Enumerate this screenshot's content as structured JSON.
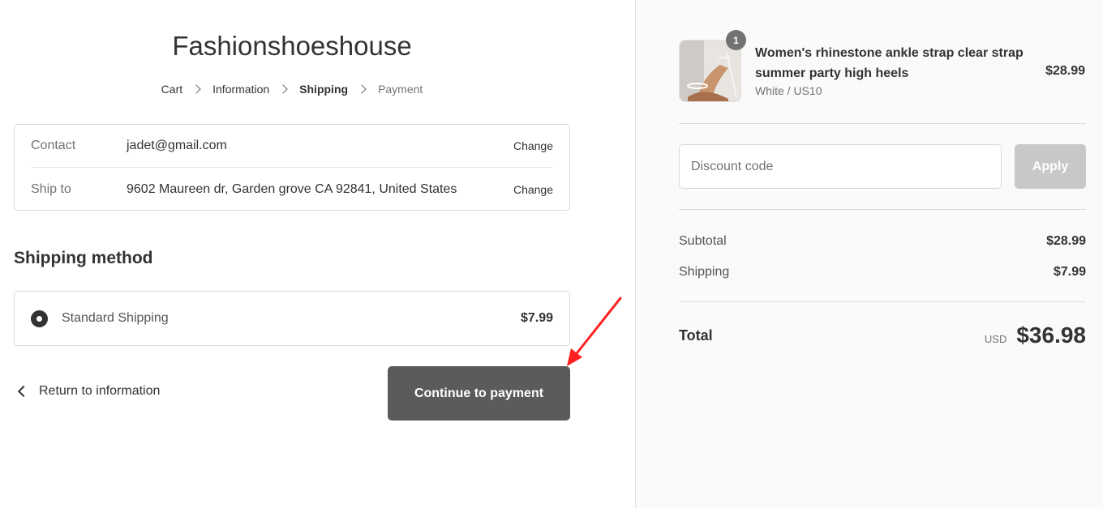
{
  "store": {
    "title": "Fashionshoeshouse"
  },
  "breadcrumb": [
    "Cart",
    "Information",
    "Shipping",
    "Payment"
  ],
  "review": {
    "contact_label": "Contact",
    "contact_value": "jadet@gmail.com",
    "ship_label": "Ship to",
    "ship_value": "9602 Maureen dr, Garden grove CA 92841, United States",
    "change_label": "Change"
  },
  "shipping_method": {
    "title": "Shipping method",
    "option_name": "Standard Shipping",
    "option_price": "$7.99"
  },
  "actions": {
    "return_label": "Return to information",
    "continue_label": "Continue to payment"
  },
  "order": {
    "product_name": "Women's rhinestone ankle strap clear strap summer party high heels",
    "variant": "White / US10",
    "price": "$28.99",
    "quantity": "1"
  },
  "discount": {
    "placeholder": "Discount code",
    "apply_label": "Apply"
  },
  "summary": {
    "subtotal_label": "Subtotal",
    "subtotal_value": "$28.99",
    "shipping_label": "Shipping",
    "shipping_value": "$7.99",
    "total_label": "Total",
    "currency": "USD",
    "total_value": "$36.98"
  },
  "colors": {
    "button_dark": "#5b5b5b",
    "button_disabled": "#c8c8c8",
    "annotation_arrow": "#ff2020"
  }
}
